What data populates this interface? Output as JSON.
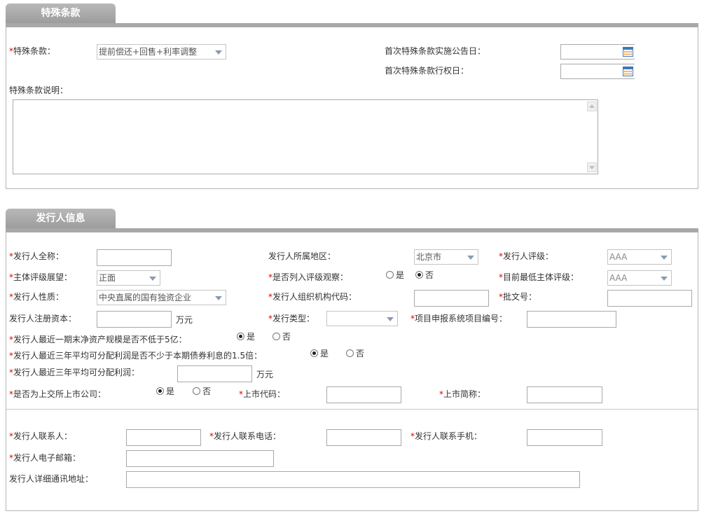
{
  "special": {
    "tab_title": "特殊条款",
    "clause_label": "特殊条款：",
    "clause_value": "提前偿还+回售+利率调整",
    "first_notice_label": "首次特殊条款实施公告日：",
    "first_exercise_label": "首次特殊条款行权日：",
    "desc_label": "特殊条款说明："
  },
  "issuer": {
    "tab_title": "发行人信息",
    "fullname_label": "发行人全称：",
    "region_label": "发行人所属地区：",
    "region_value": "北京市",
    "rating_label": "发行人评级：",
    "rating_value": "AAA",
    "outlook_label": "主体评级展望：",
    "outlook_value": "正面",
    "watch_label": "是否列入评级观察：",
    "watch_yes": "是",
    "watch_no": "否",
    "lowest_rating_label": "目前最低主体评级：",
    "lowest_rating_value": "AAA",
    "nature_label": "发行人性质：",
    "nature_value": "中央直属的国有独资企业",
    "orgcode_label": "发行人组织机构代码：",
    "approval_label": "批文号：",
    "capital_label": "发行人注册资本：",
    "capital_unit": "万元",
    "issue_type_label": "发行类型：",
    "project_no_label": "项目申报系统项目编号：",
    "net_assets_label": "发行人最近一期末净资产规模是否不低于5亿：",
    "net_assets_yes": "是",
    "net_assets_no": "否",
    "profit_ratio_label": "发行人最近三年平均可分配利润是否不少于本期债券利息的1.5倍：",
    "profit_ratio_yes": "是",
    "profit_ratio_no": "否",
    "avg_profit_label": "发行人最近三年平均可分配利润：",
    "avg_profit_unit": "万元",
    "listed_label": "是否为上交所上市公司：",
    "listed_yes": "是",
    "listed_no": "否",
    "stock_code_label": "上市代码：",
    "stock_abbr_label": "上市简称：",
    "contact_label": "发行人联系人：",
    "phone_label": "发行人联系电话：",
    "mobile_label": "发行人联系手机：",
    "email_label": "发行人电子邮箱：",
    "address_label": "发行人详细通讯地址："
  },
  "required_mark": "*",
  "colors": {
    "required": "#e00000",
    "tab": "#a8a8a8"
  }
}
